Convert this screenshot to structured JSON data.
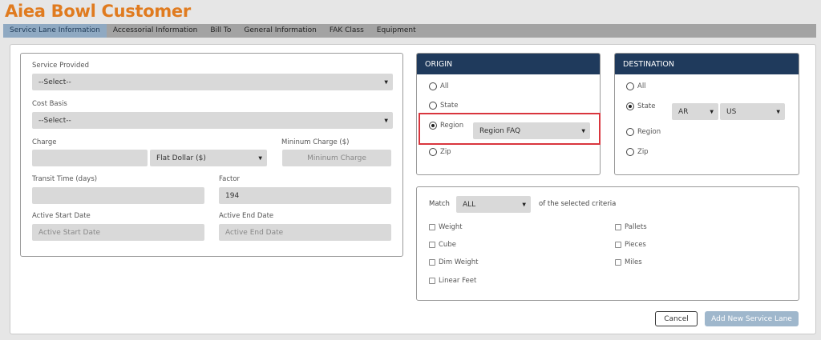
{
  "app": {
    "title": "Aiea Bowl Customer"
  },
  "tabs": [
    {
      "label": "Service Lane Information",
      "active": true
    },
    {
      "label": "Accessorial Information"
    },
    {
      "label": "Bill To"
    },
    {
      "label": "General Information"
    },
    {
      "label": "FAK Class"
    },
    {
      "label": "Equipment"
    }
  ],
  "form": {
    "service_provided": {
      "label": "Service Provided",
      "value": "--Select--"
    },
    "cost_basis": {
      "label": "Cost Basis",
      "value": "--Select--"
    },
    "charge": {
      "label": "Charge",
      "value": "",
      "unit": "Flat Dollar ($)"
    },
    "minimum_charge": {
      "label": "Mininum Charge ($)",
      "placeholder": "Mininum Charge"
    },
    "transit_time": {
      "label": "Transit Time (days)",
      "value": ""
    },
    "factor": {
      "label": "Factor",
      "value": "194"
    },
    "active_start": {
      "label": "Active Start Date",
      "placeholder": "Active Start Date"
    },
    "active_end": {
      "label": "Active End Date",
      "placeholder": "Active End Date"
    }
  },
  "origin": {
    "title": "ORIGIN",
    "options": [
      "All",
      "State",
      "Region",
      "Zip"
    ],
    "selected": "Region",
    "region_value": "Region FAQ"
  },
  "destination": {
    "title": "DESTINATION",
    "options": [
      "All",
      "State",
      "Region",
      "Zip"
    ],
    "selected": "State",
    "state_value": "AR",
    "country_value": "US"
  },
  "criteria": {
    "match_label": "Match",
    "match_value": "ALL",
    "suffix": "of the selected criteria",
    "left": [
      "Weight",
      "Cube",
      "Dim Weight",
      "Linear Feet"
    ],
    "right": [
      "Pallets",
      "Pieces",
      "Miles"
    ]
  },
  "buttons": {
    "cancel": "Cancel",
    "add": "Add New Service Lane"
  },
  "colors": {
    "accent_title": "#e07b1f",
    "panel_header": "#1f3a5c",
    "highlight": "#d9363e",
    "primary_disabled": "#9fb7cc"
  }
}
